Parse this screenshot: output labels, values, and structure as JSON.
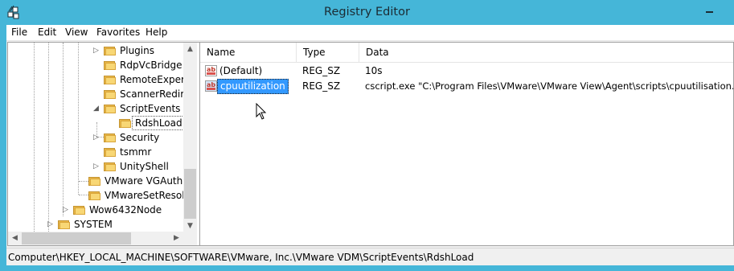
{
  "window": {
    "title": "Registry Editor"
  },
  "menu": [
    "File",
    "Edit",
    "View",
    "Favorites",
    "Help"
  ],
  "tree": {
    "nodes": [
      {
        "label": "Plugins",
        "expander": "collapsed",
        "selected": false
      },
      {
        "label": "RdpVcBridge",
        "expander": "none",
        "selected": false
      },
      {
        "label": "RemoteExperie",
        "expander": "none",
        "selected": false
      },
      {
        "label": "ScannerRedire",
        "expander": "none",
        "selected": false
      },
      {
        "label": "ScriptEvents",
        "expander": "expanded",
        "selected": false
      },
      {
        "label": "RdshLoad",
        "expander": "none",
        "selected": true
      },
      {
        "label": "Security",
        "expander": "collapsed",
        "selected": false
      },
      {
        "label": "tsmmr",
        "expander": "none",
        "selected": false
      },
      {
        "label": "UnityShell",
        "expander": "collapsed",
        "selected": false
      },
      {
        "label": "VMware VGAuth",
        "expander": "none",
        "selected": false
      },
      {
        "label": "VMwareSetResolut",
        "expander": "none",
        "selected": false
      },
      {
        "label": "Wow6432Node",
        "expander": "collapsed",
        "selected": false
      },
      {
        "label": "SYSTEM",
        "expander": "collapsed",
        "selected": false
      }
    ]
  },
  "list": {
    "columns": [
      "Name",
      "Type",
      "Data"
    ],
    "rows": [
      {
        "name": "(Default)",
        "type": "REG_SZ",
        "data": "10s",
        "selected": false
      },
      {
        "name": "cpuutilization",
        "type": "REG_SZ",
        "data": "cscript.exe \"C:\\Program Files\\VMware\\VMware View\\Agent\\scripts\\cpuutilisation.vbs\"",
        "selected": true
      }
    ]
  },
  "statusbar": {
    "path": "Computer\\HKEY_LOCAL_MACHINE\\SOFTWARE\\VMware, Inc.\\VMware VDM\\ScriptEvents\\RdshLoad"
  },
  "icons": {
    "app": "registry-editor-icon",
    "folder": "folder-icon",
    "string_value": "string-value-icon",
    "tree_collapsed": "chevron-right-icon",
    "tree_expanded": "chevron-down-icon"
  },
  "colors": {
    "titlebar": "#45b6d8",
    "selection": "#3399ff",
    "folder": "#f8d775"
  }
}
